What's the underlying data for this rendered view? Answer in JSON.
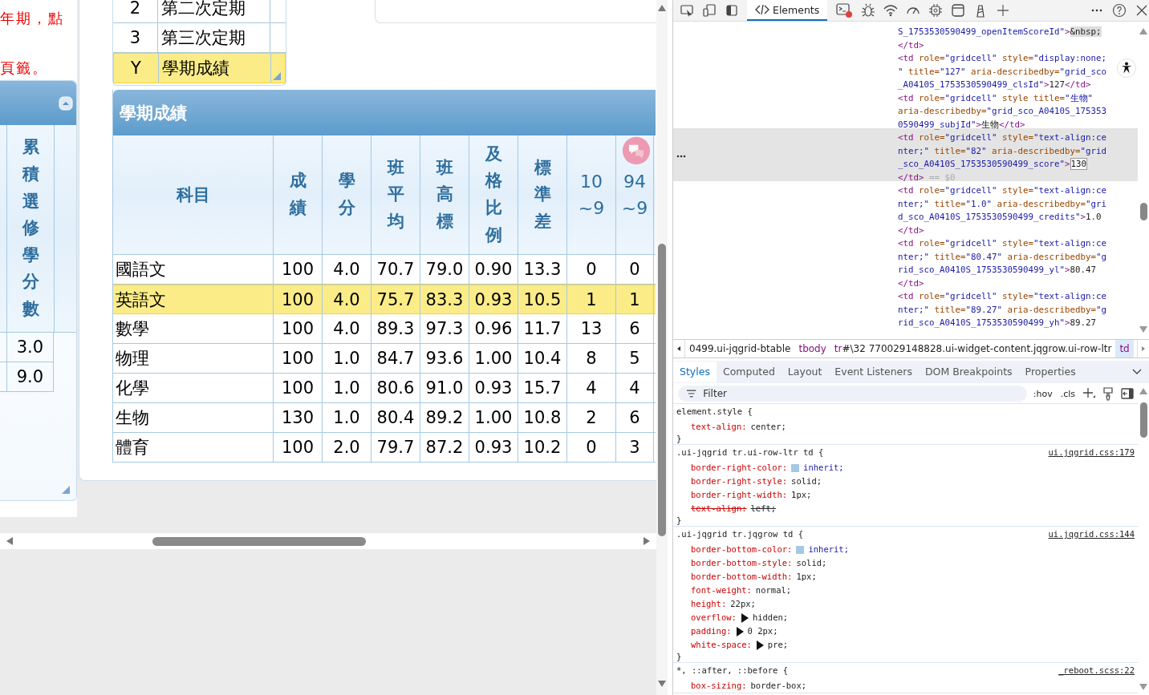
{
  "page": {
    "notice_lines": [
      "年期，點",
      "頁籤。"
    ],
    "left_grid": {
      "header": "累積選修學分數",
      "rows": [
        "3.0",
        "9.0"
      ]
    },
    "exam_list": [
      {
        "code": "2",
        "name": "第二次定期",
        "selected": false
      },
      {
        "code": "3",
        "name": "第三次定期",
        "selected": false
      },
      {
        "code": "Y",
        "name": "學期成績",
        "selected": true
      }
    ],
    "grade_grid": {
      "caption": "學期成績",
      "columns": [
        {
          "label": "科目",
          "kind": "flat"
        },
        {
          "label": "成績",
          "kind": "vertical"
        },
        {
          "label": "學分",
          "kind": "vertical"
        },
        {
          "label": "班平均",
          "kind": "vertical"
        },
        {
          "label": "班高標",
          "kind": "vertical"
        },
        {
          "label": "及格比例",
          "kind": "vertical"
        },
        {
          "label": "標準差",
          "kind": "vertical"
        },
        {
          "label": "10\n~9",
          "kind": "wrapped"
        },
        {
          "label": "94\n~9",
          "kind": "wrapped"
        }
      ],
      "rows": [
        {
          "selected": false,
          "cells": [
            "國語文",
            "100",
            "4.0",
            "70.7",
            "79.0",
            "0.90",
            "13.3",
            "0",
            "0"
          ]
        },
        {
          "selected": true,
          "cells": [
            "英語文",
            "100",
            "4.0",
            "75.7",
            "83.3",
            "0.93",
            "10.5",
            "1",
            "1"
          ]
        },
        {
          "selected": false,
          "cells": [
            "數學",
            "100",
            "4.0",
            "89.3",
            "97.3",
            "0.96",
            "11.7",
            "13",
            "6"
          ]
        },
        {
          "selected": false,
          "cells": [
            "物理",
            "100",
            "1.0",
            "84.7",
            "93.6",
            "1.00",
            "10.4",
            "8",
            "5"
          ]
        },
        {
          "selected": false,
          "cells": [
            "化學",
            "100",
            "1.0",
            "80.6",
            "91.0",
            "0.93",
            "15.7",
            "4",
            "4"
          ]
        },
        {
          "selected": false,
          "cells": [
            "生物",
            "130",
            "1.0",
            "80.4",
            "89.2",
            "1.00",
            "10.8",
            "2",
            "6"
          ]
        },
        {
          "selected": false,
          "cells": [
            "體育",
            "100",
            "2.0",
            "79.7",
            "87.2",
            "0.93",
            "10.2",
            "0",
            "3"
          ]
        }
      ]
    }
  },
  "devtools": {
    "tabs": [
      {
        "label": "Elements",
        "selected": true
      }
    ],
    "dom_lines": [
      {
        "selected": false,
        "parts": [
          {
            "kind": "value",
            "text": "S_1753530590499_openItemScoreId\""
          },
          {
            "kind": "tag",
            "text": ">"
          },
          {
            "kind": "entity",
            "text": "&nbsp;"
          }
        ]
      },
      {
        "selected": false,
        "parts": [
          {
            "kind": "tag",
            "text": "</td>"
          }
        ]
      },
      {
        "selected": false,
        "parts": [
          {
            "kind": "tag",
            "text": "<td"
          },
          {
            "kind": "attr",
            "text": " role="
          },
          {
            "kind": "value",
            "text": "\"gridcell\""
          },
          {
            "kind": "attr",
            "text": " style="
          },
          {
            "kind": "value",
            "text": "\"display:none;"
          }
        ]
      },
      {
        "selected": false,
        "parts": [
          {
            "kind": "value",
            "text": "\""
          },
          {
            "kind": "attr",
            "text": " title="
          },
          {
            "kind": "value",
            "text": "\"127\""
          },
          {
            "kind": "attr",
            "text": " aria-describedby="
          },
          {
            "kind": "value",
            "text": "\"grid_sco"
          }
        ]
      },
      {
        "selected": false,
        "parts": [
          {
            "kind": "value",
            "text": "_A0410S_1753530590499_clsId\""
          },
          {
            "kind": "tag",
            "text": ">"
          },
          {
            "kind": "text",
            "text": "127"
          },
          {
            "kind": "tag",
            "text": "</td>"
          }
        ]
      },
      {
        "selected": false,
        "parts": [
          {
            "kind": "tag",
            "text": "<td"
          },
          {
            "kind": "attr",
            "text": " role="
          },
          {
            "kind": "value",
            "text": "\"gridcell\""
          },
          {
            "kind": "attr",
            "text": " style title="
          },
          {
            "kind": "value",
            "text": "\"生物\""
          }
        ]
      },
      {
        "selected": false,
        "parts": [
          {
            "kind": "attr",
            "text": "aria-describedby="
          },
          {
            "kind": "value",
            "text": "\"grid_sco_A0410S_175353"
          }
        ]
      },
      {
        "selected": false,
        "parts": [
          {
            "kind": "value",
            "text": "0590499_subjId\""
          },
          {
            "kind": "tag",
            "text": ">"
          },
          {
            "kind": "text",
            "text": "生物"
          },
          {
            "kind": "tag",
            "text": "</td>"
          }
        ]
      },
      {
        "selected": true,
        "parts": [
          {
            "kind": "tag",
            "text": "<td"
          },
          {
            "kind": "attr",
            "text": " role="
          },
          {
            "kind": "value",
            "text": "\"gridcell\""
          },
          {
            "kind": "attr",
            "text": " style="
          },
          {
            "kind": "value",
            "text": "\"text-align:ce"
          }
        ]
      },
      {
        "selected": true,
        "parts": [
          {
            "kind": "value",
            "text": "nter;\""
          },
          {
            "kind": "attr",
            "text": " title="
          },
          {
            "kind": "value",
            "text": "\"82\""
          },
          {
            "kind": "attr",
            "text": " aria-describedby="
          },
          {
            "kind": "value",
            "text": "\"grid"
          }
        ]
      },
      {
        "selected": true,
        "parts": [
          {
            "kind": "value",
            "text": "_sco_A0410S_1753530590499_score\""
          },
          {
            "kind": "tag",
            "text": ">"
          },
          {
            "kind": "edit",
            "text": "130"
          }
        ]
      },
      {
        "selected": true,
        "parts": [
          {
            "kind": "tag",
            "text": "</td>"
          },
          {
            "kind": "comment",
            "text": " == $0"
          }
        ]
      },
      {
        "selected": false,
        "parts": [
          {
            "kind": "tag",
            "text": "<td"
          },
          {
            "kind": "attr",
            "text": " role="
          },
          {
            "kind": "value",
            "text": "\"gridcell\""
          },
          {
            "kind": "attr",
            "text": " style="
          },
          {
            "kind": "value",
            "text": "\"text-align:ce"
          }
        ]
      },
      {
        "selected": false,
        "parts": [
          {
            "kind": "value",
            "text": "nter;\""
          },
          {
            "kind": "attr",
            "text": " title="
          },
          {
            "kind": "value",
            "text": "\"1.0\""
          },
          {
            "kind": "attr",
            "text": " aria-describedby="
          },
          {
            "kind": "value",
            "text": "\"gri"
          }
        ]
      },
      {
        "selected": false,
        "parts": [
          {
            "kind": "value",
            "text": "d_sco_A0410S_1753530590499_credits\""
          },
          {
            "kind": "tag",
            "text": ">"
          },
          {
            "kind": "text",
            "text": "1.0"
          }
        ]
      },
      {
        "selected": false,
        "parts": [
          {
            "kind": "tag",
            "text": "</td>"
          }
        ]
      },
      {
        "selected": false,
        "parts": [
          {
            "kind": "tag",
            "text": "<td"
          },
          {
            "kind": "attr",
            "text": " role="
          },
          {
            "kind": "value",
            "text": "\"gridcell\""
          },
          {
            "kind": "attr",
            "text": " style="
          },
          {
            "kind": "value",
            "text": "\"text-align:ce"
          }
        ]
      },
      {
        "selected": false,
        "parts": [
          {
            "kind": "value",
            "text": "nter;\""
          },
          {
            "kind": "attr",
            "text": " title="
          },
          {
            "kind": "value",
            "text": "\"80.47\""
          },
          {
            "kind": "attr",
            "text": " aria-describedby="
          },
          {
            "kind": "value",
            "text": "\"g"
          }
        ]
      },
      {
        "selected": false,
        "parts": [
          {
            "kind": "value",
            "text": "rid_sco_A0410S_1753530590499_yl\""
          },
          {
            "kind": "tag",
            "text": ">"
          },
          {
            "kind": "text",
            "text": "80.47"
          }
        ]
      },
      {
        "selected": false,
        "parts": [
          {
            "kind": "tag",
            "text": "</td>"
          }
        ]
      },
      {
        "selected": false,
        "parts": [
          {
            "kind": "tag",
            "text": "<td"
          },
          {
            "kind": "attr",
            "text": " role="
          },
          {
            "kind": "value",
            "text": "\"gridcell\""
          },
          {
            "kind": "attr",
            "text": " style="
          },
          {
            "kind": "value",
            "text": "\"text-align:ce"
          }
        ]
      },
      {
        "selected": false,
        "parts": [
          {
            "kind": "value",
            "text": "nter;\""
          },
          {
            "kind": "attr",
            "text": " title="
          },
          {
            "kind": "value",
            "text": "\"89.27\""
          },
          {
            "kind": "attr",
            "text": " aria-describedby="
          },
          {
            "kind": "value",
            "text": "\"g"
          }
        ]
      },
      {
        "selected": false,
        "parts": [
          {
            "kind": "value",
            "text": "rid_sco_A0410S_1753530590499_yh\""
          },
          {
            "kind": "tag",
            "text": ">"
          },
          {
            "kind": "text",
            "text": "89.27"
          }
        ]
      }
    ],
    "breadcrumbs": [
      {
        "rest": "0499.ui-jqgrid-btable",
        "selected": false
      },
      {
        "tag": "tbody",
        "selected": false
      },
      {
        "tag": "tr",
        "rest": "#\\32 770029148828.ui-widget-content.jqgrow.ui-row-ltr",
        "selected": false
      },
      {
        "tag": "td",
        "selected": true
      }
    ],
    "panel_tabs": [
      {
        "label": "Styles",
        "selected": true
      },
      {
        "label": "Computed",
        "selected": false
      },
      {
        "label": "Layout",
        "selected": false
      },
      {
        "label": "Event Listeners",
        "selected": false
      },
      {
        "label": "DOM Breakpoints",
        "selected": false
      },
      {
        "label": "Properties",
        "selected": false
      }
    ],
    "filter": {
      "placeholder": "Filter"
    },
    "style_buttons": [
      ":hov",
      ".cls"
    ],
    "rules": [
      {
        "selector": "element.style {",
        "close": "}",
        "props": [
          {
            "name": "text-align:",
            "value": "center;",
            "overridden": false,
            "expandable": false,
            "swatch": false
          }
        ]
      },
      {
        "selector": ".ui-jqgrid tr.ui-row-ltr td {",
        "source": "ui.jqgrid.css:179",
        "close": "}",
        "props": [
          {
            "name": "border-right-color:",
            "value": "inherit;",
            "swatch": true,
            "overridden": false,
            "expandable": false
          },
          {
            "name": "border-right-style:",
            "value": "solid;",
            "swatch": false,
            "overridden": false,
            "expandable": false
          },
          {
            "name": "border-right-width:",
            "value": "1px;",
            "swatch": false,
            "overridden": false,
            "expandable": false
          },
          {
            "name": "text-align:",
            "value": "left;",
            "swatch": false,
            "overridden": true,
            "expandable": false
          }
        ]
      },
      {
        "selector": ".ui-jqgrid tr.jqgrow td {",
        "source": "ui.jqgrid.css:144",
        "close": "}",
        "props": [
          {
            "name": "border-bottom-color:",
            "value": "inherit;",
            "swatch": true,
            "overridden": false,
            "expandable": false
          },
          {
            "name": "border-bottom-style:",
            "value": "solid;",
            "swatch": false,
            "overridden": false,
            "expandable": false
          },
          {
            "name": "border-bottom-width:",
            "value": "1px;",
            "swatch": false,
            "overridden": false,
            "expandable": false
          },
          {
            "name": "font-weight:",
            "value": "normal;",
            "swatch": false,
            "overridden": false,
            "expandable": false
          },
          {
            "name": "height:",
            "value": "22px;",
            "swatch": false,
            "overridden": false,
            "expandable": false
          },
          {
            "name": "overflow:",
            "value": "hidden;",
            "swatch": false,
            "overridden": false,
            "expandable": true
          },
          {
            "name": "padding:",
            "value": "0 2px;",
            "swatch": false,
            "overridden": false,
            "expandable": true
          },
          {
            "name": "white-space:",
            "value": "pre;",
            "swatch": false,
            "overridden": false,
            "expandable": true
          }
        ]
      },
      {
        "selector": "*, ::after, ::before {",
        "source": "_reboot.scss:22",
        "props": [
          {
            "name": "box-sizing:",
            "value": "border-box;",
            "swatch": false,
            "overridden": false,
            "expandable": false
          }
        ]
      }
    ]
  }
}
